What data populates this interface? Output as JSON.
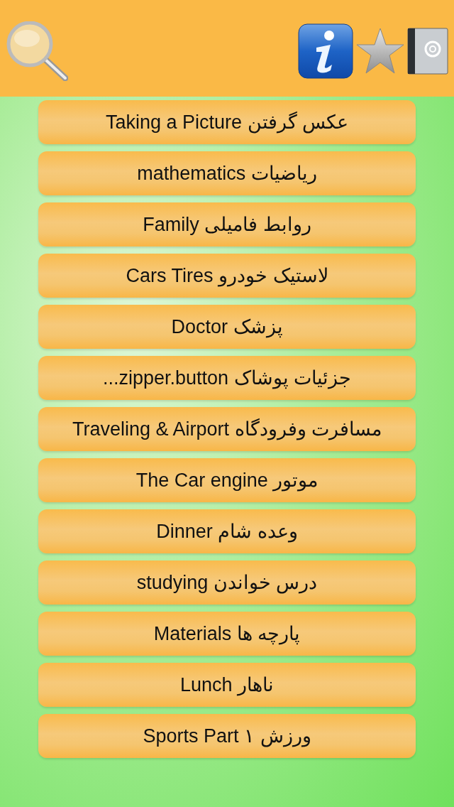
{
  "header": {
    "icons": [
      {
        "kind": "search"
      },
      {
        "kind": "info"
      },
      {
        "kind": "favorites"
      },
      {
        "kind": "contacts"
      }
    ]
  },
  "topics": [
    {
      "label": "عکس گرفتن Taking a Picture"
    },
    {
      "label": "ریاضیات mathematics"
    },
    {
      "label": "روابط فامیلی Family"
    },
    {
      "label": "لاستیک خودرو Cars Tires"
    },
    {
      "label": "پزشک Doctor"
    },
    {
      "label": "جزئیات پوشاک zipper.button..."
    },
    {
      "label": "مسافرت وفرودگاه  Traveling & Airport"
    },
    {
      "label": "موتور The Car engine"
    },
    {
      "label": "وعده شام Dinner"
    },
    {
      "label": "درس خواندن studying"
    },
    {
      "label": "پارچه ها Materials"
    },
    {
      "label": "ناهار Lunch"
    },
    {
      "label": "ورزش ۱ Sports Part"
    }
  ]
}
